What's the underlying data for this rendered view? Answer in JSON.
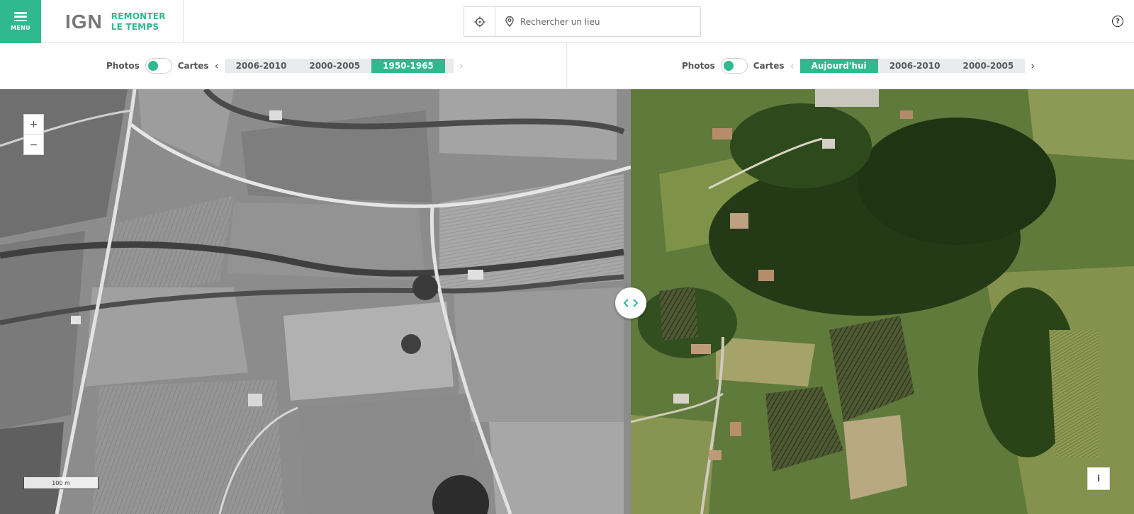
{
  "header": {
    "menu_label": "MENU",
    "logo_text": "IGN",
    "brand_line1": "REMONTER",
    "brand_line2": "LE TEMPS",
    "search_placeholder": "Rechercher un lieu",
    "help_label": "?"
  },
  "left_panel": {
    "photos_label": "Photos",
    "cartes_label": "Cartes",
    "mode": "photos",
    "years": [
      "2006-2010",
      "2000-2005",
      "1950-1965"
    ],
    "selected_year": "1950-1965"
  },
  "right_panel": {
    "photos_label": "Photos",
    "cartes_label": "Cartes",
    "mode": "photos",
    "years": [
      "Aujourd'hui",
      "2006-2010",
      "2000-2005"
    ],
    "selected_year": "Aujourd'hui"
  },
  "map": {
    "zoom_in": "+",
    "zoom_out": "−",
    "scale_label": "100 m",
    "info_label": "i"
  },
  "colors": {
    "accent": "#2fb98d",
    "logo_leaf": "#a3c93a"
  }
}
